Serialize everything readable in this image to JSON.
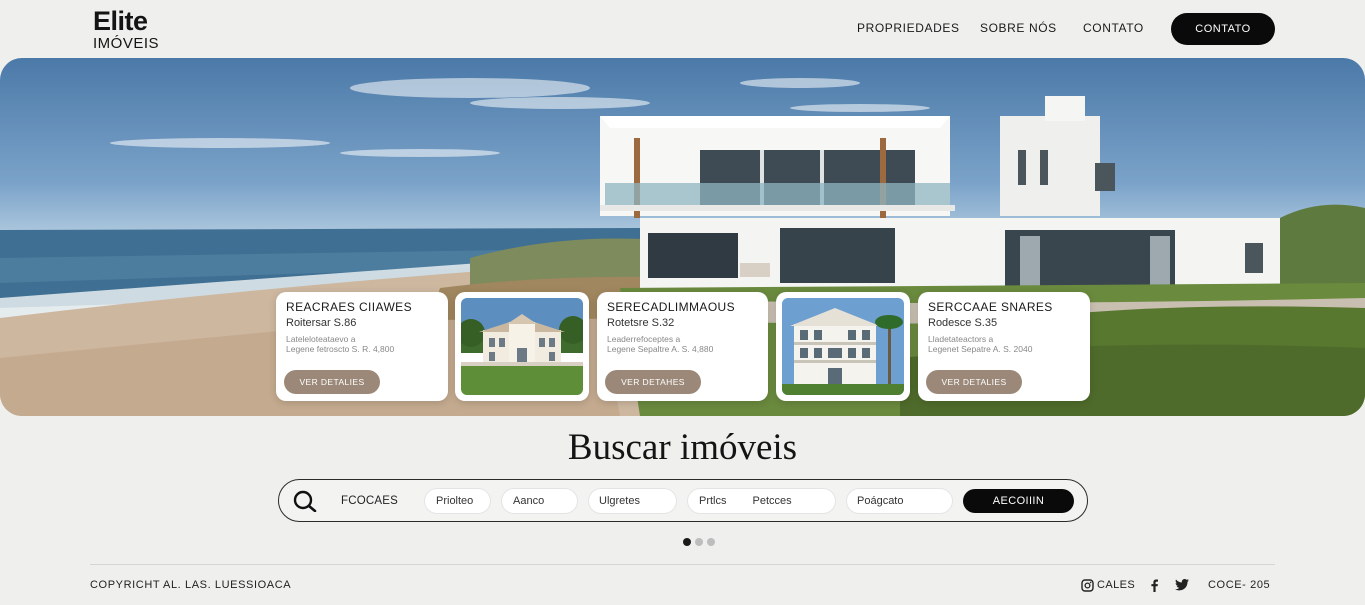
{
  "brand": {
    "line1": "Elite",
    "line2": "IMÓVEIS"
  },
  "nav": {
    "items": [
      "PROPRIEDADES",
      "SOBRE NÓS",
      "CONTATO"
    ],
    "cta": "CONTATO"
  },
  "hero": {
    "image": "beachfront-villa-photo"
  },
  "cards": [
    {
      "title": "REACRAES CIIAWES",
      "price": "Roitersar S.86",
      "detail1": "Lateleloteataevo a",
      "detail2": "Legene fetroscto S. R. 4,800",
      "button": "VER DETALIES"
    },
    {
      "title": "SERECADLIMMAOUS",
      "price": "Rotetsre S.32",
      "detail1": "Leaderrefoceptes a",
      "detail2": "Legene Sepaltre A. S. 4,880",
      "button": "VER DETAHES"
    },
    {
      "title": "SERCCAAE SNARES",
      "price": "Rodesce S.35",
      "detail1": "Lladetateactors a",
      "detail2": "Legenet Sepatre A. S. 2040",
      "button": "VER DETALIES"
    }
  ],
  "photo_cards": [
    {
      "icon": "mansion-photo"
    },
    {
      "icon": "colonial-house-photo"
    }
  ],
  "search": {
    "title": "Buscar imóveis",
    "label": "FCOCAES",
    "filters": [
      "Priolteo",
      "Aanco",
      "Ulgretes",
      "Prtlcs",
      "Petcces",
      "Poágcato"
    ],
    "button": "AECOIIIN"
  },
  "carousel": {
    "total": 3,
    "active": 0
  },
  "footer": {
    "copyright": "COPYRICHT AL. LAS. LUESSIOACA",
    "social_label": "CALES",
    "code": "COCE- 205",
    "icons": [
      "instagram-icon",
      "facebook-icon",
      "twitter-icon"
    ]
  }
}
